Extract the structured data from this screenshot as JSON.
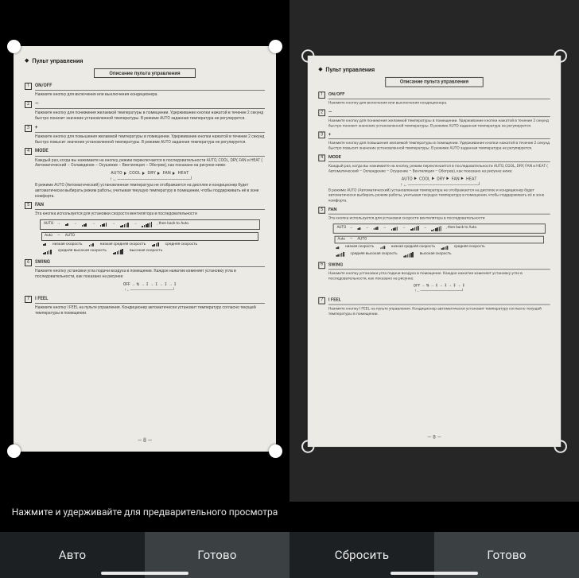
{
  "left": {
    "hint": "Нажмите и удерживайте для предварительного просмотра",
    "toolbar": {
      "secondary": "Авто",
      "primary": "Готово"
    }
  },
  "right": {
    "toolbar": {
      "secondary": "Сбросить",
      "primary": "Готово"
    }
  },
  "doc": {
    "header_title": "Пульт управления",
    "subheader": "Описание пульта управления",
    "page_number": "— 8 —",
    "items": {
      "1": {
        "name": "ON/OFF",
        "desc": "Нажмите кнопку для включения или выключения кондиционера."
      },
      "2": {
        "name": "—",
        "desc": "Нажмите кнопку для понижения желаемой температуры в помещении. Удерживание кнопки нажатой в течение 2 секунд быстро понизит значение установленной температуры. В режиме AUTO заданная температура не регулируется."
      },
      "3": {
        "name": "+",
        "desc": "Нажмите кнопку для повышения желаемой температуры в помещении. Удерживание кнопки нажатой в течение 2 секунд быстро повысит значение установленной температуры. В режиме AUTO заданная температура не регулируется."
      },
      "4": {
        "name": "MODE",
        "desc1": "Каждый раз, когда вы нажимаете на кнопку, режим переключается в последовательности AUTO, COOL, DRY, FAN и HEAT  ( Автоматический – Охлаждение – Осушение – Вентиляция – Обогрев), как показано на рисунке ниже:",
        "modes": [
          "AUTO",
          "COOL",
          "DRY",
          "FAN",
          "HEAT"
        ],
        "desc2": "В режиме AUTO (Автоматический) установленная температура не отображается на дисплее и кондиционер будет автоматически выбирать режим работы, учитывая текущую температуру в помещении, чтобы поддерживать её в зоне комфорта."
      },
      "5": {
        "name": "FAN",
        "desc": "Эта кнопка используется для установки скорости вентилятора в последовательности",
        "auto_label": "AUTO",
        "back_label": ", then back to Auto.",
        "auto_word": "Auto",
        "speeds": {
          "low": "низкая скорость",
          "lowmid": "низкая средняя скорость",
          "mid": "средняя скорость",
          "midhigh": "средняя высокая скорость",
          "high": "высокая скорость"
        }
      },
      "6": {
        "name": "SWING",
        "desc": "Нажмите кнопку установки угла подачи воздуха в помещение. Каждое нажатие изменяет установку угла в последовательности, как показано на рисунке:",
        "off_label": "OFF"
      },
      "7": {
        "name": "I FEEL",
        "desc": "Нажмите кнопку I FEEL на пульте управления. Кондиционер автоматически установит температуру согласно текущей температуры в помещении."
      }
    }
  }
}
